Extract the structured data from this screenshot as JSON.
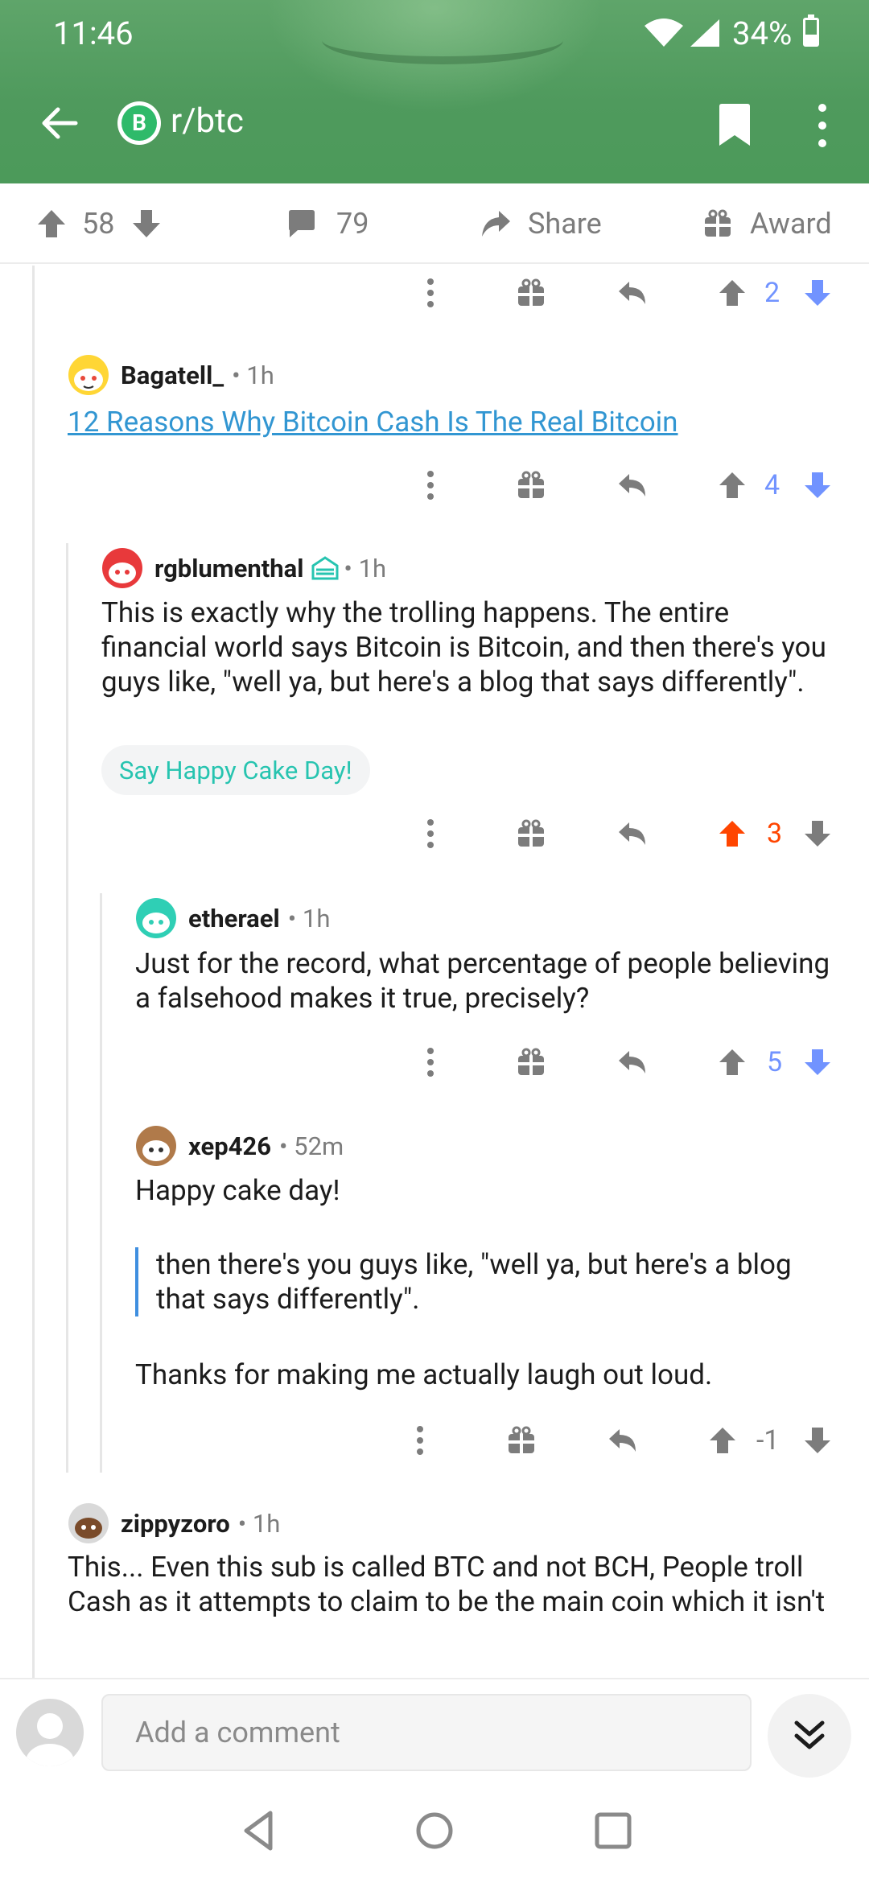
{
  "status": {
    "time": "11:46",
    "battery": "34%"
  },
  "header": {
    "subreddit": "r/btc",
    "sub_icon_glyph": "B"
  },
  "post_actions": {
    "upvotes": "58",
    "comments": "79",
    "share": "Share",
    "award": "Award"
  },
  "colors": {
    "header_green": "#4f9a5d",
    "upvote_active": "#ff4500",
    "downvote_active": "#7193ff",
    "link_blue": "#3296d2",
    "cake_teal": "#27c4b0"
  },
  "comments": [
    {
      "id": "c0",
      "score": "2",
      "vote": "down"
    },
    {
      "id": "c1",
      "user": "Bagatell_",
      "time": "1h",
      "link": "12 Reasons Why Bitcoin Cash Is The Real Bitcoin",
      "score": "4",
      "vote": "down"
    },
    {
      "id": "c2",
      "user": "rgblumenthal",
      "time": "1h",
      "body": "This is exactly why the trolling happens. The entire financial world says Bitcoin is Bitcoin, and then there's you guys like, \"well ya, but here's a blog that says differently\".",
      "cake": "Say Happy Cake Day!",
      "score": "3",
      "vote": "up"
    },
    {
      "id": "c3",
      "user": "etherael",
      "time": "1h",
      "body": "Just for the record, what percentage of people believing a falsehood makes it true, precisely?",
      "score": "5",
      "vote": "down"
    },
    {
      "id": "c4",
      "user": "xep426",
      "time": "52m",
      "body_top": "Happy cake day!",
      "quote": "then there's you guys like, \"well ya, but here's a blog that says differently\".",
      "body_bottom": "Thanks for making me actually laugh out loud.",
      "score": "-1",
      "vote": "none"
    },
    {
      "id": "c5",
      "user": "zippyzoro",
      "time": "1h",
      "body": "This... Even this sub is called BTC and not BCH, People troll Cash as it attempts to claim to be the main coin which it isn't"
    }
  ],
  "composer": {
    "placeholder": "Add a comment"
  }
}
